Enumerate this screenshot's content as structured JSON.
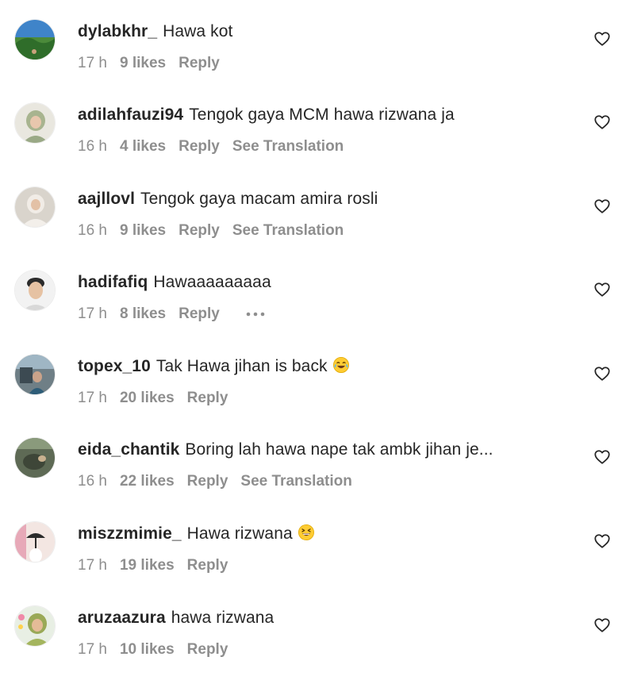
{
  "colors": {
    "text_primary": "#262626",
    "text_secondary": "#8e8e8e",
    "background": "#ffffff"
  },
  "comments": [
    {
      "username": "dylabkhr_",
      "text": "Hawa kot",
      "emoji": "",
      "time": "17 h",
      "likes": "9 likes",
      "reply": "Reply",
      "translation": "",
      "more": false
    },
    {
      "username": "adilahfauzi94",
      "text": "Tengok gaya MCM hawa rizwana ja",
      "emoji": "",
      "time": "16 h",
      "likes": "4 likes",
      "reply": "Reply",
      "translation": "See Translation",
      "more": false
    },
    {
      "username": "aajllovl",
      "text": "Tengok gaya macam amira rosli",
      "emoji": "",
      "time": "16 h",
      "likes": "9 likes",
      "reply": "Reply",
      "translation": "See Translation",
      "more": false
    },
    {
      "username": "hadifafiq",
      "text": "Hawaaaaaaaaa",
      "emoji": "",
      "time": "17 h",
      "likes": "8 likes",
      "reply": "Reply",
      "translation": "",
      "more": true
    },
    {
      "username": "topex_10",
      "text": "Tak Hawa jihan is back",
      "emoji": "laughing-crying-emoji",
      "time": "17 h",
      "likes": "20 likes",
      "reply": "Reply",
      "translation": "",
      "more": false
    },
    {
      "username": "eida_chantik",
      "text": "Boring lah hawa nape tak ambk jihan je...",
      "emoji": "",
      "time": "16 h",
      "likes": "22 likes",
      "reply": "Reply",
      "translation": "See Translation",
      "more": false
    },
    {
      "username": "miszzmimie_",
      "text": "Hawa rizwana",
      "emoji": "grinning-squinting-emoji",
      "time": "17 h",
      "likes": "19 likes",
      "reply": "Reply",
      "translation": "",
      "more": false
    },
    {
      "username": "aruzaazura",
      "text": "hawa rizwana",
      "emoji": "",
      "time": "17 h",
      "likes": "10 likes",
      "reply": "Reply",
      "translation": "",
      "more": false
    }
  ]
}
